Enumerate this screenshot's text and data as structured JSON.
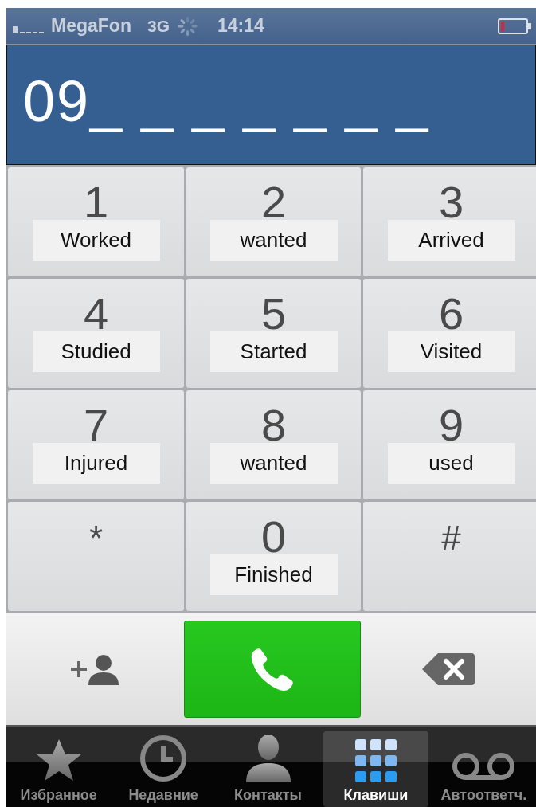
{
  "status_bar": {
    "carrier": "MegaFon",
    "network": "3G",
    "time": "14:14"
  },
  "display": {
    "number": "09_ _ _ _ _ _ _"
  },
  "keys": [
    {
      "digit": "1",
      "label": "Worked"
    },
    {
      "digit": "2",
      "label": "wanted"
    },
    {
      "digit": "3",
      "label": "Arrived"
    },
    {
      "digit": "4",
      "label": "Studied"
    },
    {
      "digit": "5",
      "label": "Started"
    },
    {
      "digit": "6",
      "label": "Visited"
    },
    {
      "digit": "7",
      "label": "Injured"
    },
    {
      "digit": "8",
      "label": "wanted"
    },
    {
      "digit": "9",
      "label": "used"
    },
    {
      "digit": "*"
    },
    {
      "digit": "0",
      "label": "Finished"
    },
    {
      "digit": "#"
    }
  ],
  "tabs": [
    {
      "label": "Избранное",
      "selected": false
    },
    {
      "label": "Недавние",
      "selected": false
    },
    {
      "label": "Контакты",
      "selected": false
    },
    {
      "label": "Клавиши",
      "selected": true
    },
    {
      "label": "Автоответч.",
      "selected": false
    }
  ]
}
